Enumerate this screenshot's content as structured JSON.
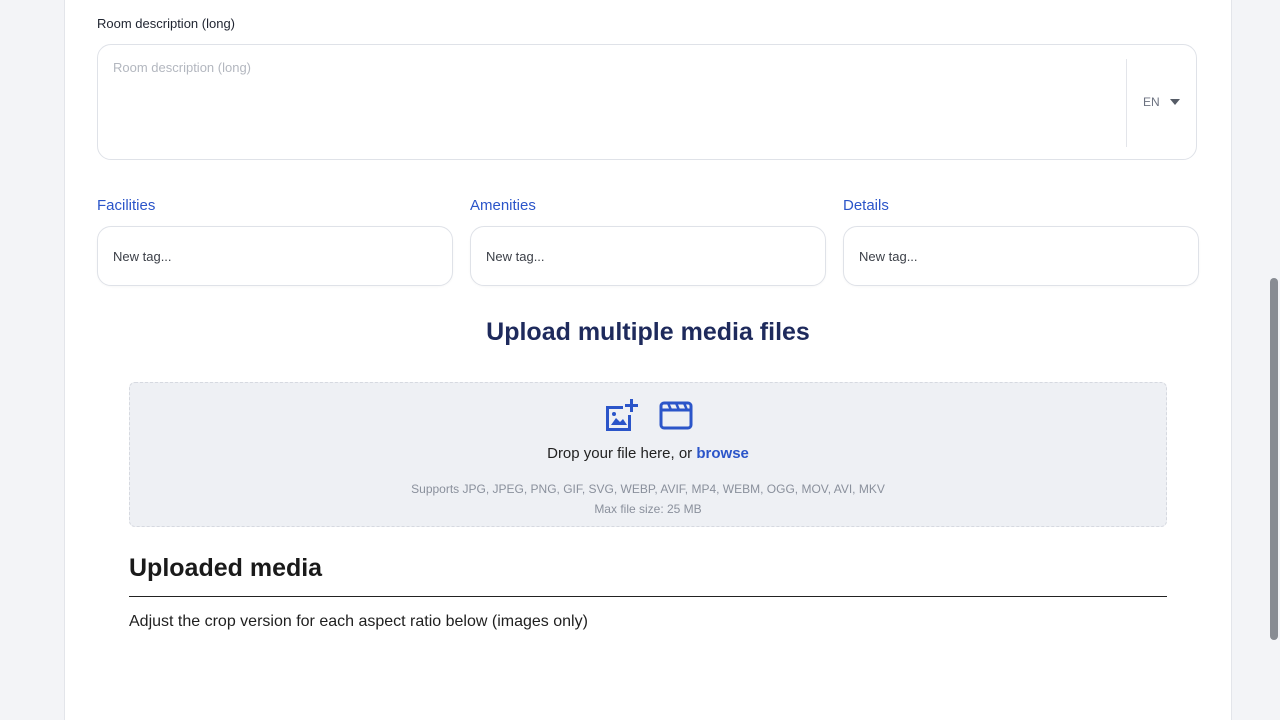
{
  "description_long": {
    "label": "Room description (long)",
    "placeholder": "Room description (long)",
    "language": "EN"
  },
  "tags": {
    "facilities": {
      "label": "Facilities",
      "placeholder": "New tag..."
    },
    "amenities": {
      "label": "Amenities",
      "placeholder": "New tag..."
    },
    "details": {
      "label": "Details",
      "placeholder": "New tag..."
    }
  },
  "upload": {
    "title": "Upload multiple media files",
    "drop_text": "Drop your file here, or",
    "browse_label": "browse",
    "supports": "Supports JPG, JPEG, PNG, GIF, SVG, WEBP, AVIF, MP4, WEBM, OGG, MOV, AVI, MKV",
    "max_size": "Max file size: 25 MB",
    "icons": [
      "add-image-icon",
      "video-clapper-icon"
    ]
  },
  "uploaded_media": {
    "title": "Uploaded media",
    "subtitle": "Adjust the crop version for each aspect ratio below (images only)"
  },
  "colors": {
    "accent": "#2b55c9",
    "heading": "#1e2a5c",
    "dropzone_bg": "#eef0f4"
  }
}
